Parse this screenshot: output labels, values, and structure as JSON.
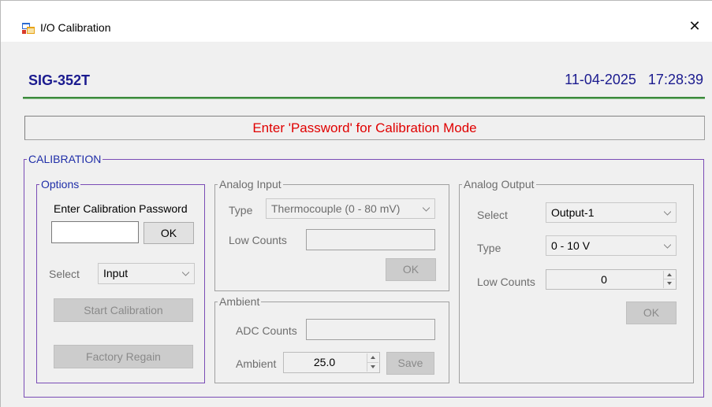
{
  "window": {
    "title": "I/O Calibration",
    "close_glyph": "✕",
    "icon": "app-window-icon"
  },
  "header": {
    "model": "SIG-352T",
    "date": "11-04-2025",
    "time": "17:28:39",
    "model_color": "#1b1b8f"
  },
  "message": {
    "text": "Enter 'Password' for Calibration Mode",
    "color": "#e00000"
  },
  "calibration": {
    "title": "CALIBRATION",
    "options": {
      "title": "Options",
      "password_label": "Enter Calibration Password",
      "password_value": "",
      "ok_label": "OK",
      "select_label": "Select",
      "select_value": "Input",
      "start_label": "Start Calibration",
      "factory_label": "Factory Regain"
    },
    "analog_input": {
      "title": "Analog Input",
      "type_label": "Type",
      "type_value": "Thermocouple (0 - 80 mV)",
      "low_counts_label": "Low Counts",
      "low_counts_value": "",
      "ok_label": "OK"
    },
    "ambient": {
      "title": "Ambient",
      "adc_label": "ADC Counts",
      "adc_value": "",
      "ambient_label": "Ambient",
      "ambient_value": "25.0",
      "save_label": "Save"
    },
    "analog_output": {
      "title": "Analog Output",
      "select_label": "Select",
      "select_value": "Output-1",
      "type_label": "Type",
      "type_value": "0 - 10 V",
      "low_counts_label": "Low Counts",
      "low_counts_value": "0",
      "ok_label": "OK"
    }
  },
  "colors": {
    "accent_purple": "#7a4cb6",
    "label_blue": "#1f2ea8",
    "divider_green": "#3c8a3c"
  }
}
